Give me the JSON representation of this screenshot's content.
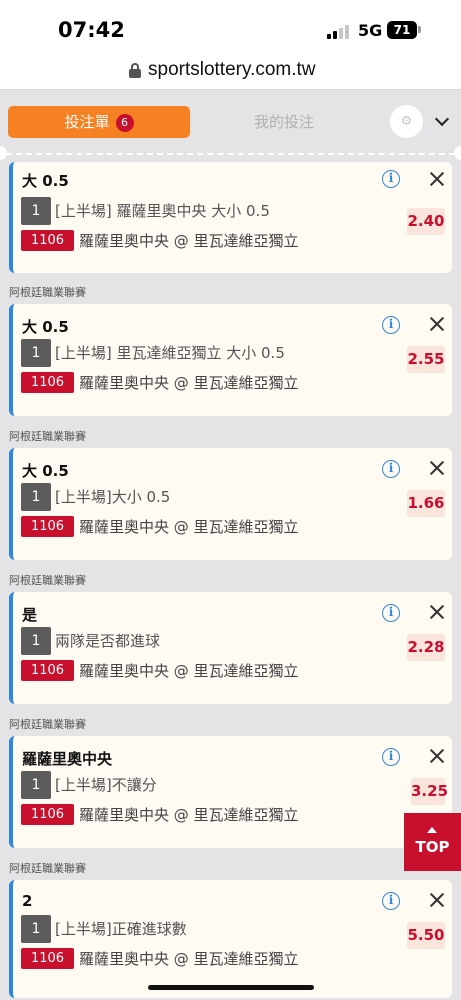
{
  "status_bar": {
    "time": "07:42",
    "network": "5G",
    "battery": "71"
  },
  "browser": {
    "url": "sportslottery.com.tw"
  },
  "betslip": {
    "tab_betslip": "投注單",
    "badge_count": "6",
    "tab_mybets": "我的投注",
    "settings_icon": "⚙"
  },
  "league_label": "阿根廷職業聯賽",
  "bets": [
    {
      "selection": "大 0.5",
      "index": "1",
      "market": "[上半場] 羅薩里奧中央 大小 0.5",
      "match_code": "1106",
      "match": "羅薩里奧中央 @ 里瓦達維亞獨立",
      "odds": "2.40"
    },
    {
      "selection": "大 0.5",
      "index": "1",
      "market": "[上半場] 里瓦達維亞獨立 大小 0.5",
      "match_code": "1106",
      "match": "羅薩里奧中央 @ 里瓦達維亞獨立",
      "odds": "2.55"
    },
    {
      "selection": "大 0.5",
      "index": "1",
      "market": "[上半場]大小 0.5",
      "match_code": "1106",
      "match": "羅薩里奧中央 @ 里瓦達維亞獨立",
      "odds": "1.66"
    },
    {
      "selection": "是",
      "index": "1",
      "market": "兩隊是否都進球",
      "match_code": "1106",
      "match": "羅薩里奧中央 @ 里瓦達維亞獨立",
      "odds": "2.28"
    },
    {
      "selection": "羅薩里奧中央",
      "index": "1",
      "market": "[上半場]不讓分",
      "match_code": "1106",
      "match": "羅薩里奧中央 @ 里瓦達維亞獨立",
      "odds": "3.25"
    },
    {
      "selection": "2",
      "index": "1",
      "market": "[上半場]正確進球數",
      "match_code": "1106",
      "match": "羅薩里奧中央 @ 里瓦達維亞獨立",
      "odds": "5.50"
    }
  ],
  "top_button": "TOP",
  "info_icon_glyph": "i",
  "colors": {
    "accent_orange": "#f68122",
    "brand_red": "#c8102e",
    "info_blue": "#2e86de"
  }
}
